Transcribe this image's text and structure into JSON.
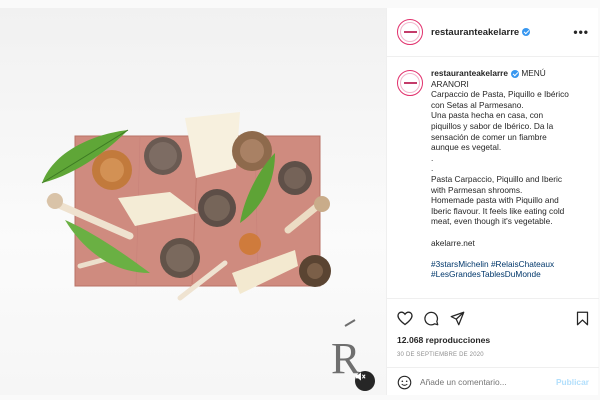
{
  "post": {
    "username": "restauranteakelarre",
    "more_label": "•••",
    "caption": {
      "username": "restauranteakelarre",
      "lines": [
        "MENÚ",
        "ARANORI",
        "Carpaccio de Pasta, Piquillo e Ibérico",
        "con Setas al Parmesano.",
        "Una pasta hecha en casa, con",
        "piquillos y sabor de Ibérico. Da la",
        "sensación de comer un fiambre",
        "aunque es vegetal.",
        ".",
        ".",
        "Pasta Carpaccio, Piquillo and Iberic",
        "with Parmesan shrooms.",
        "Homemade pasta with Piquillo and",
        "Iberic flavour. It feels like eating cold",
        "meat, even though it's vegetable."
      ],
      "website": "akelarre.net",
      "hashtags_line1": "#3starsMichelin #RelaisChateaux",
      "hashtags_line2": "#LesGrandesTablesDuMonde"
    },
    "views": "12.068 reproducciones",
    "date": "30 DE SEPTIEMBRE DE 2020",
    "comment_placeholder": "Añade un comentario...",
    "publish_label": "Publicar"
  },
  "colors": {
    "verified": "#3897f0",
    "publish": "#b2dffc",
    "muted_text": "#8e8e8e"
  },
  "icons": {
    "like": "heart-icon",
    "comment": "comment-icon",
    "share": "share-icon",
    "save": "bookmark-icon",
    "mute": "speaker-muted-icon",
    "emoji": "smiley-icon"
  }
}
